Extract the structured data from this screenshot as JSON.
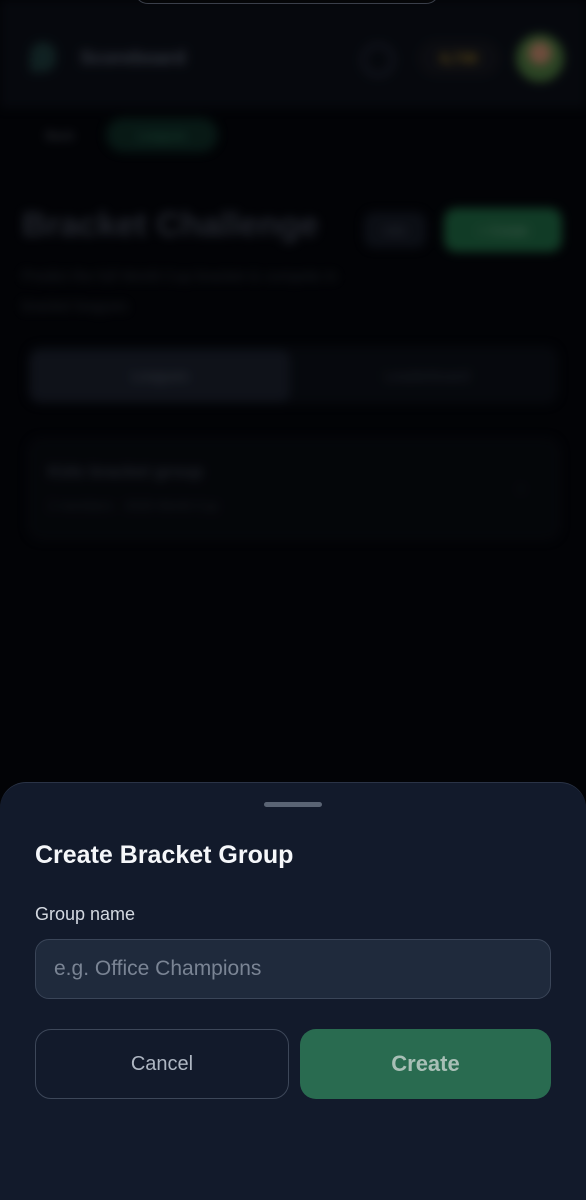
{
  "background": {
    "brand": "Scoreboard",
    "coins": "6,730",
    "chips": {
      "back": "Back",
      "active": "Leagues"
    },
    "hero_title": "Bracket Challenge",
    "info_label": "Info",
    "create_label": "+ Create",
    "hero_subtitle": "Predict the full World Cup bracket & compete in bracket leagues",
    "tabs": [
      "Leagues",
      "Leaderboard"
    ],
    "group": {
      "name": "Kids bracket group",
      "meta": "2 members · 2026 World Cup"
    }
  },
  "sheet": {
    "title": "Create Bracket Group",
    "field_label": "Group name",
    "input_placeholder": "e.g. Office Champions",
    "input_value": "",
    "cancel_label": "Cancel",
    "create_label": "Create"
  },
  "colors": {
    "sheet_bg": "#121a2b",
    "create_button": "#296b50",
    "page_bg": "#020306"
  }
}
